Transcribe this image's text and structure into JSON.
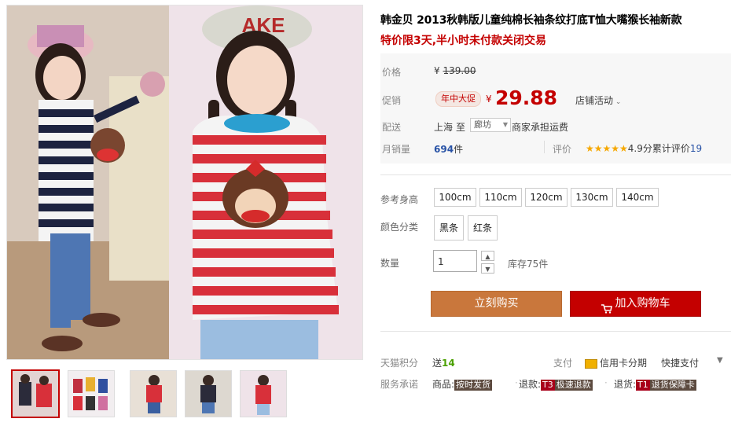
{
  "product": {
    "title": "韩金贝 2013秋韩版儿童纯棉长袖条纹打底T恤大嘴猴长袖新款",
    "subtitle": "特价限3天,半小时未付款关闭交易"
  },
  "price": {
    "label": "价格",
    "currency": "¥",
    "original": "139.00"
  },
  "promo": {
    "label": "促销",
    "badge": "年中大促",
    "currency": "¥",
    "price": "29.88",
    "activity": "店铺活动"
  },
  "shipping": {
    "label": "配送",
    "from": "上海",
    "to_word": "至",
    "destination": "廊坊",
    "note": "商家承担运费"
  },
  "sales": {
    "label": "月销量",
    "count": "694",
    "unit": "件",
    "rating_label": "评价",
    "stars": "★★★★★",
    "score_text": "4.9分累计评价",
    "review_count": "19"
  },
  "size": {
    "label": "参考身高",
    "options": [
      "100cm",
      "110cm",
      "120cm",
      "130cm",
      "140cm"
    ]
  },
  "color": {
    "label": "颜色分类",
    "options": [
      "黑条",
      "红条"
    ]
  },
  "quantity": {
    "label": "数量",
    "value": "1",
    "stock": "库存75件"
  },
  "actions": {
    "buy": "立刻购买",
    "cart": "加入购物车"
  },
  "points": {
    "label": "天猫积分",
    "give_text": "送",
    "value": "14"
  },
  "payment": {
    "label": "支付",
    "credit": "信用卡分期",
    "quick": "快捷支付"
  },
  "service": {
    "label": "服务承诺",
    "goods_label": "商品:",
    "goods_tag": "按时发货",
    "refund_label": "退款:",
    "refund_code": "T3",
    "refund_tag": "极速退款",
    "return_label": "退货:",
    "return_code": "T1",
    "return_tag": "退货保障卡"
  },
  "colors": {
    "accent": "#c40000",
    "buy_button": "#c9773c",
    "cart_button": "#c40000",
    "star": "#f6a800"
  }
}
